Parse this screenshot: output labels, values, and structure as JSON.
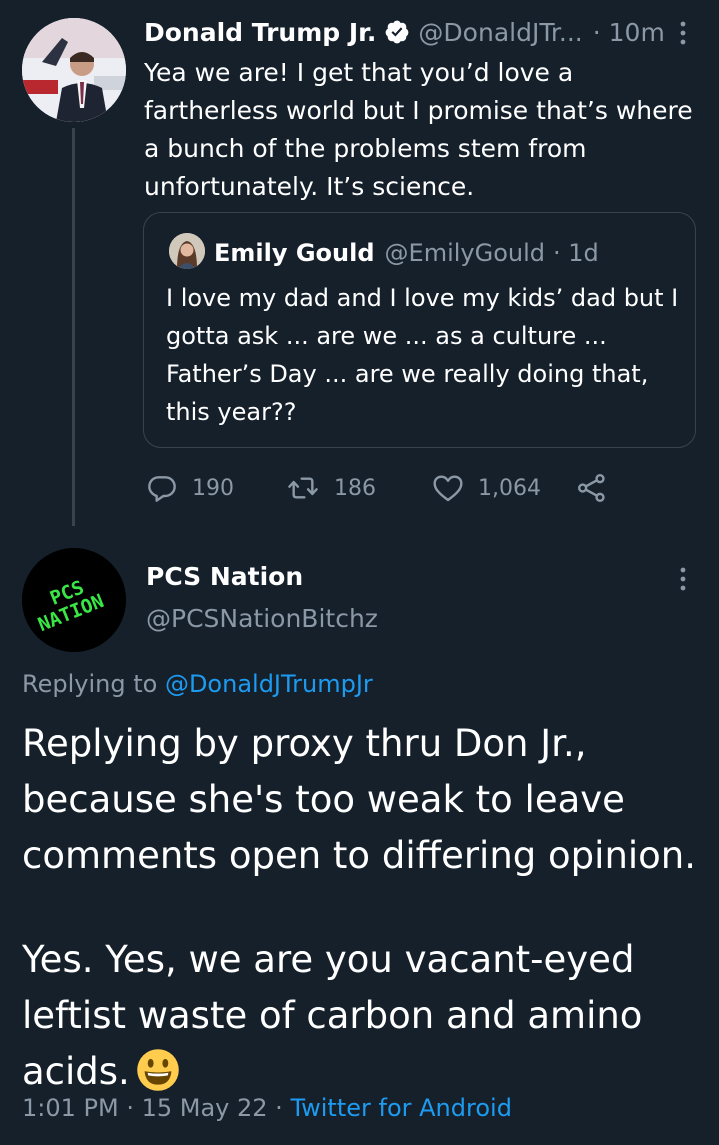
{
  "parent_tweet": {
    "author_name": "Donald Trump Jr.",
    "handle": "@DonaldJTr...",
    "time": "· 10m",
    "text": "Yea we are! I get that you’d love a fartherless world but I promise that’s where a bunch of the problems stem from unfortunately. It’s science.",
    "quoted": {
      "author_name": "Emily Gould",
      "handle": "@EmilyGould",
      "time": "· 1d",
      "text": "I love my dad and I love my kids’ dad but I gotta ask ... are we ... as a culture ... Father’s Day ... are we really doing that, this year??"
    },
    "actions": {
      "replies": "190",
      "retweets": "186",
      "likes": "1,064"
    }
  },
  "main_tweet": {
    "avatar_text": "PCS NATION",
    "author_name": "PCS Nation",
    "handle": "@PCSNationBitchz",
    "replying_prefix": "Replying to ",
    "replying_to": "@DonaldJTrumpJr",
    "text_paragraph_1": "Replying by proxy thru Don Jr., because she's too weak to leave comments open to differing opinion.",
    "text_paragraph_2": "Yes. Yes, we are you vacant-eyed leftist waste of carbon and amino acids.",
    "emoji": "smiley-face-emoji",
    "timestamp": "1:01 PM · 15 May 22 · ",
    "source": "Twitter for Android"
  },
  "colors": {
    "background": "#15202b",
    "text": "#ffffff",
    "muted": "#8b98a5",
    "link": "#1d9bf0",
    "border": "#38444d",
    "logo_green": "#39e646"
  }
}
